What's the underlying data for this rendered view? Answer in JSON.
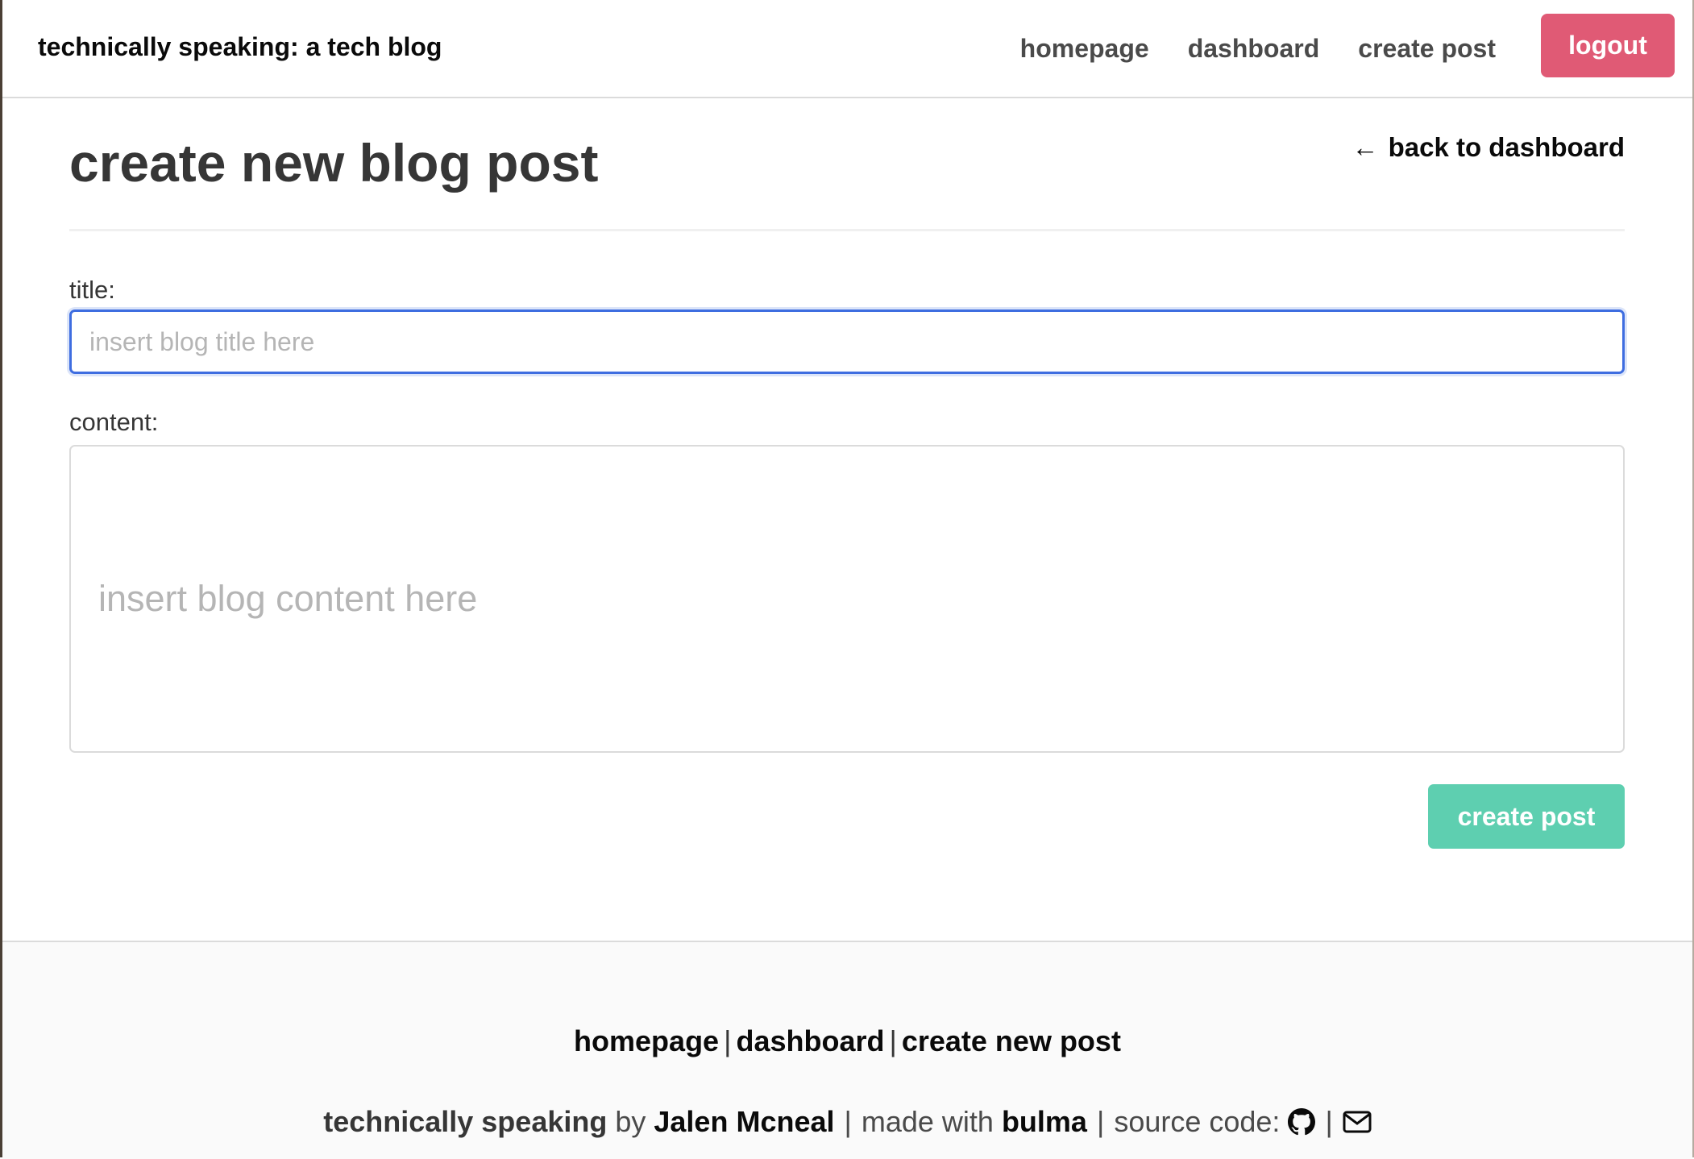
{
  "navbar": {
    "brand": "technically speaking: a tech blog",
    "links": [
      {
        "label": "homepage"
      },
      {
        "label": "dashboard"
      },
      {
        "label": "create post"
      }
    ],
    "logout_label": "logout"
  },
  "main": {
    "title": "create new blog post",
    "back_arrow": "←",
    "back_label": "back to dashboard",
    "title_field": {
      "label": "title:",
      "placeholder": "insert blog title here",
      "value": ""
    },
    "content_field": {
      "label": "content:",
      "placeholder": "insert blog content here",
      "value": ""
    },
    "submit_label": "create post"
  },
  "footer": {
    "links": [
      "homepage",
      "dashboard",
      "create new post"
    ],
    "separator": "|",
    "site_name": "technically speaking",
    "by_text": "by",
    "author": "Jalen Mcneal",
    "made_with_text": "made with",
    "framework": "bulma",
    "source_code_text": "source code:",
    "icons": [
      "github-icon",
      "email-icon"
    ]
  },
  "colors": {
    "logout_bg": "#e05a75",
    "create_btn_bg": "#5ecfb0",
    "input_focus_border": "#3e6de0"
  }
}
